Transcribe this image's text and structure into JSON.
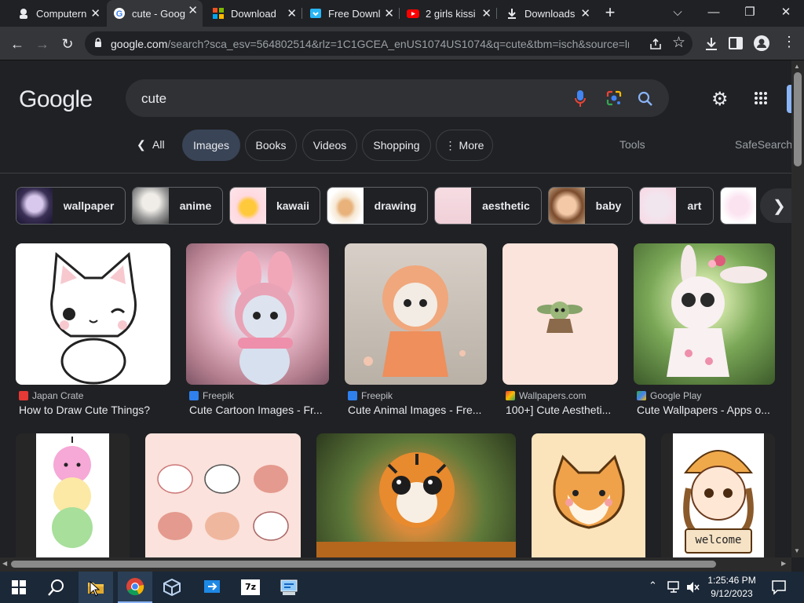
{
  "tabs": [
    {
      "label": "Computern",
      "icon": "computer-hope-icon"
    },
    {
      "label": "cute - Goog",
      "icon": "google-icon"
    },
    {
      "label": "Download",
      "icon": "windows-icon"
    },
    {
      "label": "Free Downl",
      "icon": "download-site-icon"
    },
    {
      "label": "2 girls kissi",
      "icon": "youtube-icon"
    },
    {
      "label": "Downloads",
      "icon": "download-icon"
    }
  ],
  "url": {
    "host": "google.com",
    "path": "/search?sca_esv=564802514&rlz=1C1GCEA_enUS1074US1074&q=cute&tbm=isch&source=ln..."
  },
  "logo": "Google",
  "search": {
    "query": "cute"
  },
  "filters": {
    "all": "All",
    "images": "Images",
    "books": "Books",
    "videos": "Videos",
    "shopping": "Shopping",
    "more": "More",
    "tools": "Tools",
    "safesearch": "SafeSearch"
  },
  "related": [
    "wallpaper",
    "anime",
    "kawaii",
    "drawing",
    "aesthetic",
    "baby",
    "art"
  ],
  "results": [
    {
      "source": "Japan Crate",
      "title": "How to Draw Cute Things?"
    },
    {
      "source": "Freepik",
      "title": "Cute Cartoon Images - Fr..."
    },
    {
      "source": "Freepik",
      "title": "Cute Animal Images - Fre..."
    },
    {
      "source": "Wallpapers.com",
      "title": "100+] Cute Aestheti..."
    },
    {
      "source": "Google Play",
      "title": "Cute Wallpapers - Apps o..."
    }
  ],
  "welcome_sign": "welcome",
  "taskbar": {
    "time": "1:25:46 PM",
    "date": "9/12/2023",
    "app_7z": "7z"
  },
  "colors": {
    "background": "#202124",
    "chip_selected": "#394457",
    "taskbar": "#1b2838"
  }
}
